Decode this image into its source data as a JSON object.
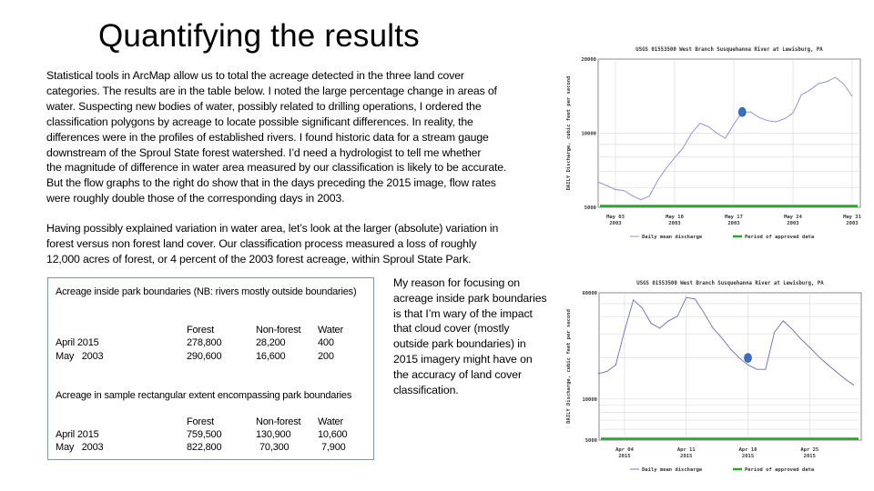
{
  "slide": {
    "title": "Quantifying the results",
    "paragraph1_lines": [
      "Statistical tools in ArcMap allow us to total the acreage detected in the three land cover",
      "categories.  The results are in the table below.  I noted the large percentage change in areas of",
      "water.  Suspecting new bodies of water, possibly related to drilling operations, I ordered the",
      "classification polygons by acreage to locate possible significant differences.  In reality, the",
      "differences were in the profiles of established rivers.  I found historic data for a stream gauge",
      "downstream of the Sproul State forest watershed.  I’d need a hydrologist to tell me whether",
      "the magnitude of difference in water area measured by our classification is likely to be accurate.",
      "But the flow graphs to the right do show that in the days preceding the 2015 image, flow rates",
      "were roughly double those of the corresponding days in 2003."
    ],
    "paragraph2_lines": [
      "Having possibly explained variation in water area, let’s look at the larger (absolute) variation in",
      "forest versus non forest land cover.  Our classification process measured a loss of roughly",
      "12,000 acres of forest, or 4 percent of the 2003 forest acreage, within Sproul State Park."
    ],
    "note_lines": [
      "My reason for focusing on",
      "acreage inside park boundaries",
      "is that I’m wary of the impact",
      "that cloud cover (mostly",
      "outside park boundaries) in",
      "2015 imagery might have on",
      "the accuracy of land cover",
      "classification."
    ]
  },
  "tables": [
    {
      "caption": "Acreage inside park boundaries (NB: rivers mostly outside boundaries)",
      "headers": [
        "",
        "Forest",
        "Non-forest",
        "Water"
      ],
      "rows": [
        [
          "April 2015",
          "278,800",
          "28,200",
          "400"
        ],
        [
          "May   2003",
          "290,600",
          "16,600",
          "200"
        ]
      ]
    },
    {
      "caption": "Acreage in sample rectangular extent encompassing park boundaries",
      "headers": [
        "",
        "Forest",
        "Non-forest",
        "Water"
      ],
      "rows": [
        [
          "April 2015",
          "759,500",
          "130,900",
          "10,600"
        ],
        [
          "May   2003",
          "822,800",
          "70,300",
          "7,900"
        ]
      ]
    }
  ],
  "chart_data": [
    {
      "type": "line",
      "title": "USGS 01553500 West Branch Susquehanna River at Lewisburg, PA",
      "ylabel": "DAILY Discharge, cubic feet per second",
      "y_scale": "log",
      "ylim": [
        5000,
        20000
      ],
      "y_ticks": [
        "5000",
        "10000",
        "20000"
      ],
      "x_ticks": [
        {
          "date": "2003-05-03",
          "label": [
            "May 03",
            "2003"
          ]
        },
        {
          "date": "2003-05-10",
          "label": [
            "May 10",
            "2003"
          ]
        },
        {
          "date": "2003-05-17",
          "label": [
            "May 17",
            "2003"
          ]
        },
        {
          "date": "2003-05-24",
          "label": [
            "May 24",
            "2003"
          ]
        },
        {
          "date": "2003-05-31",
          "label": [
            "May 31",
            "2003"
          ]
        }
      ],
      "x_start": "2003-05-01",
      "grid": true,
      "legend": [
        "Daily mean discharge",
        "Period of approved data"
      ],
      "legend_placement": "bottom",
      "colors": {
        "line": "#8a8ad0",
        "approved": "#22aa22",
        "marker": "#3a6fc4"
      },
      "series": [
        {
          "name": "Daily mean discharge",
          "values": [
            6330,
            6120,
            5900,
            5850,
            5570,
            5370,
            5540,
            6420,
            7200,
            7950,
            8710,
            10000,
            10970,
            10630,
            10000,
            9540,
            10880,
            12190,
            12190,
            11580,
            11250,
            11130,
            11450,
            12080,
            14330,
            14960,
            15880,
            16200,
            16860,
            15840,
            14130
          ]
        }
      ],
      "highlight": {
        "date": "2003-05-18",
        "value": 12190
      }
    },
    {
      "type": "line",
      "title": "USGS 01553500 West Branch Susquehanna River at Lewisburg, PA",
      "ylabel": "DAILY Discharge, cubic feet per second",
      "y_scale": "log",
      "ylim": [
        5000,
        60000
      ],
      "y_ticks": [
        "5000",
        "10000",
        "60000"
      ],
      "x_ticks": [
        {
          "date": "2015-04-04",
          "label": [
            "Apr 04",
            "2015"
          ]
        },
        {
          "date": "2015-04-11",
          "label": [
            "Apr 11",
            "2015"
          ]
        },
        {
          "date": "2015-04-18",
          "label": [
            "Apr 18",
            "2015"
          ]
        },
        {
          "date": "2015-04-25",
          "label": [
            "Apr 25",
            "2015"
          ]
        }
      ],
      "x_start": "2015-04-01",
      "grid": true,
      "legend": [
        "Daily mean discharge",
        "Period of approved data"
      ],
      "legend_placement": "bottom",
      "colors": {
        "line": "#6a6ab8",
        "approved": "#22aa22",
        "marker": "#3a6fc4"
      },
      "series": [
        {
          "name": "Daily mean discharge",
          "values": [
            15340,
            15900,
            17790,
            31650,
            53200,
            46370,
            35950,
            32970,
            37430,
            40410,
            55430,
            54030,
            42960,
            33290,
            28150,
            23310,
            20000,
            17790,
            16480,
            16480,
            30840,
            37430,
            32470,
            27570,
            23900,
            20520,
            17970,
            15900,
            14070,
            12640
          ]
        }
      ],
      "highlight": {
        "date": "2015-04-18",
        "value": 20000
      }
    }
  ]
}
